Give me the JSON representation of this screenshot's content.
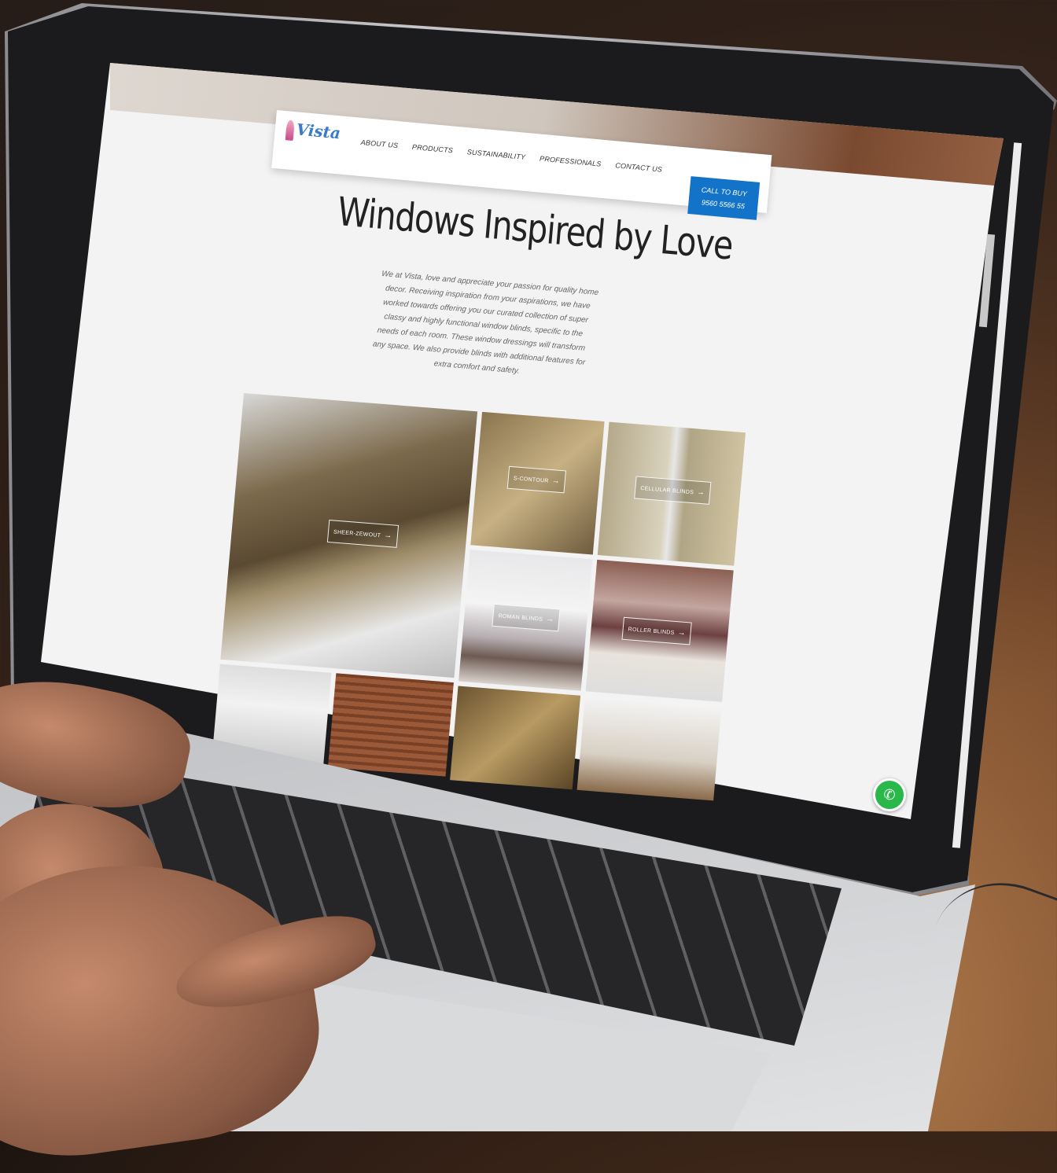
{
  "brand": {
    "logo_text": "Vista"
  },
  "nav": {
    "items": [
      "ABOUT US",
      "PRODUCTS",
      "SUSTAINABILITY",
      "PROFESSIONALS",
      "CONTACT US"
    ]
  },
  "cta": {
    "line1": "CALL TO BUY",
    "line2": "9560 5566 55"
  },
  "hero": {
    "title": "Windows Inspired by Love",
    "intro": "We at Vista, love and appreciate your passion for quality home decor. Receiving inspiration from your aspirations, we have worked towards offering you our curated collection of super classy and highly functional window blinds, specific to the needs of each room. These window dressings will transform any space. We also provide blinds with additional features for extra comfort and safety."
  },
  "tiles": [
    {
      "label": "SHEER-ZEWOUT"
    },
    {
      "label": "S-CONTOUR"
    },
    {
      "label": "CELLULAR BLINDS"
    },
    {
      "label": "ROMAN BLINDS"
    },
    {
      "label": "ROLLER BLINDS"
    }
  ],
  "colors": {
    "accent": "#1273c9",
    "whatsapp": "#2bb84a"
  },
  "icons": {
    "whatsapp": "whatsapp-icon",
    "arrow": "arrow-right-icon"
  }
}
